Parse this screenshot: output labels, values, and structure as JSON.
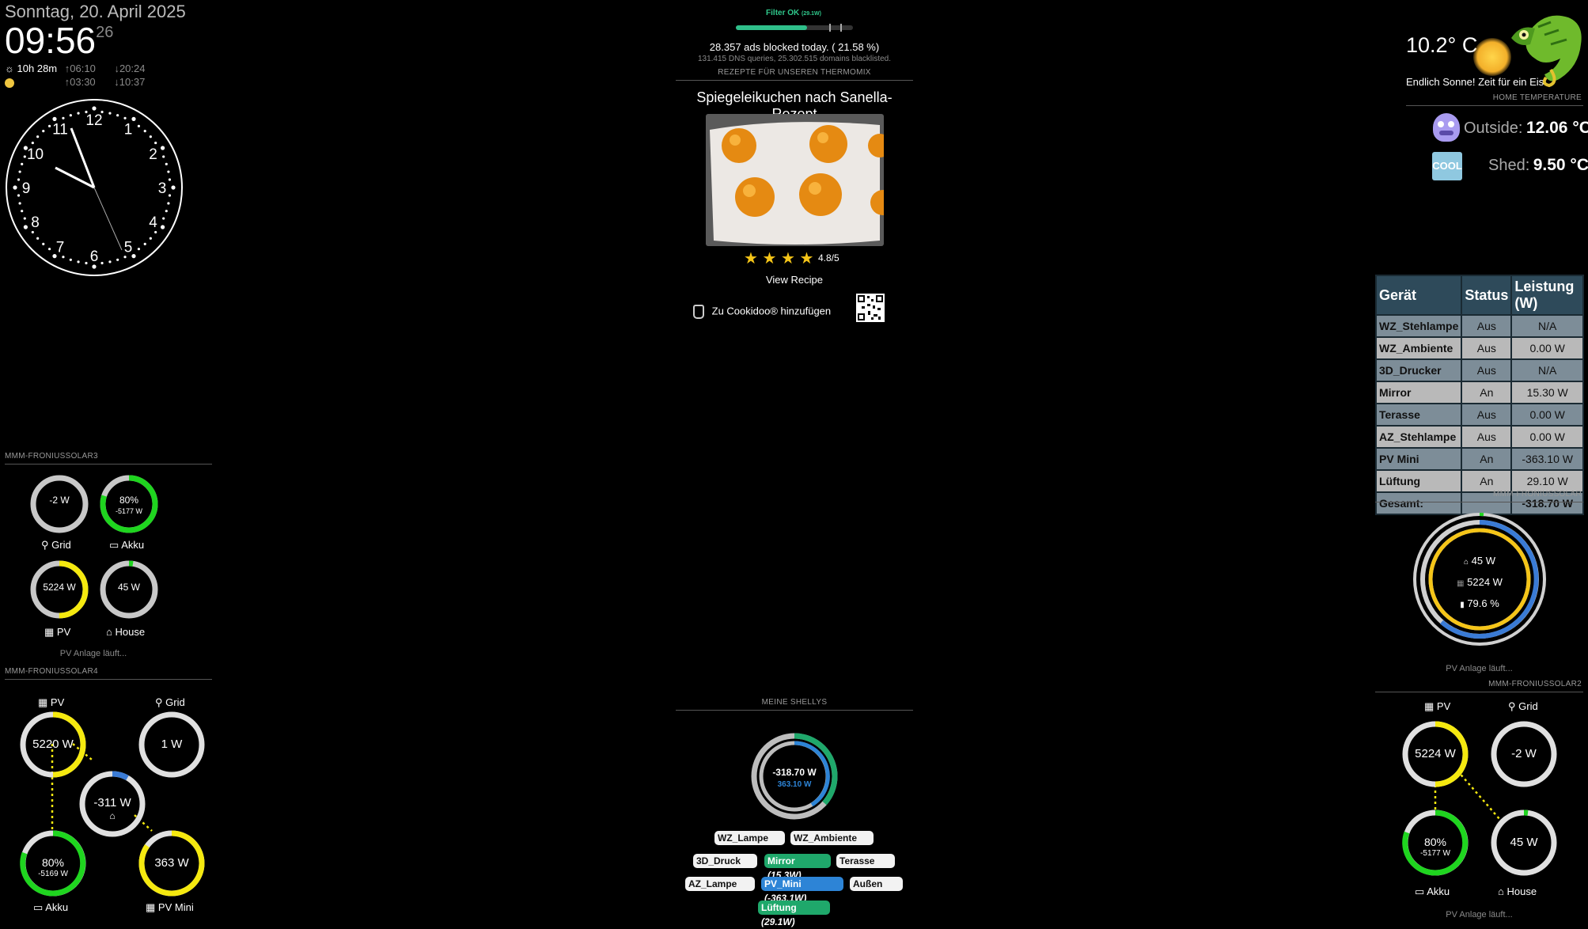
{
  "clock": {
    "date": "Sonntag, 20. April 2025",
    "time": "09:56",
    "seconds": "26",
    "daylight": "10h 28m",
    "sunrise": "06:10",
    "sunset": "20:24",
    "moonrise": "03:30",
    "moonset": "10:37",
    "analog_numbers": [
      "12",
      "1",
      "2",
      "3",
      "4",
      "5",
      "6",
      "7",
      "8",
      "9",
      "10",
      "11"
    ]
  },
  "pihole": {
    "filter": "Filter OK",
    "filter_power": "(29.1W)",
    "ads_blocked": "28.357 ads blocked today. ( 21.58 %)",
    "dns": "131.415 DNS queries, 25.302.515 domains blacklisted."
  },
  "recipe": {
    "header": "REZEPTE FÜR UNSEREN THERMOMIX",
    "title": "Spiegeleikuchen nach Sanella-Rezept",
    "rating": "4.8/5",
    "rating_value": 4.8,
    "view": "View Recipe",
    "cookidoo": "Zu Cookidoo® hinzufügen"
  },
  "weather": {
    "temp": "10.2° C",
    "text": "Endlich Sonne! Zeit für ein Eis"
  },
  "home_temp": {
    "header": "HOME TEMPERATURE",
    "outside_label": "Outside:",
    "outside_value": "12.06 °C",
    "shed_label": "Shed:",
    "shed_value": "9.50 °C",
    "cool_badge": "COOL"
  },
  "device_table": {
    "headers": [
      "Gerät",
      "Status",
      "Leistung (W)"
    ],
    "rows": [
      {
        "name": "WZ_Stehlampe",
        "status": "Aus",
        "power": "N/A"
      },
      {
        "name": "WZ_Ambiente",
        "status": "Aus",
        "power": "0.00 W"
      },
      {
        "name": "3D_Drucker",
        "status": "Aus",
        "power": "N/A"
      },
      {
        "name": "Mirror",
        "status": "An",
        "power": "15.30 W"
      },
      {
        "name": "Terasse",
        "status": "Aus",
        "power": "0.00 W"
      },
      {
        "name": "AZ_Stehlampe",
        "status": "Aus",
        "power": "0.00 W"
      },
      {
        "name": "PV Mini",
        "status": "An",
        "power": "-363.10 W"
      },
      {
        "name": "Lüftung",
        "status": "An",
        "power": "29.10 W"
      }
    ],
    "total_label": "Gesamt:",
    "total_value": "-318.70 W"
  },
  "solar3": {
    "header": "MMM-FRONIUSSOLAR3",
    "grid_value": "-2 W",
    "grid_label": "Grid",
    "akku_pct": "80%",
    "akku_sub": "-5177 W",
    "akku_label": "Akku",
    "akku_level": 0.8,
    "pv_value": "5224 W",
    "pv_label": "PV",
    "pv_level": 0.5,
    "house_value": "45 W",
    "house_label": "House",
    "status": "PV Anlage läuft..."
  },
  "solar4": {
    "header": "MMM-FRONIUSSOLAR4",
    "pv_label": "PV",
    "pv_value": "5220 W",
    "grid_label": "Grid",
    "grid_value": "1 W",
    "center_value": "-311 W",
    "akku_pct": "80%",
    "akku_sub": "-5169 W",
    "akku_label": "Akku",
    "mini_value": "363 W",
    "mini_label": "PV Mini"
  },
  "solar_ring": {
    "header": "MMM-FRONIUSSOLAR",
    "house": "45 W",
    "pv": "5224 W",
    "soc": "79.6 %",
    "status": "PV Anlage läuft..."
  },
  "solar2": {
    "header": "MMM-FRONIUSSOLAR2",
    "pv_label": "PV",
    "pv_value": "5224 W",
    "grid_label": "Grid",
    "grid_value": "-2 W",
    "akku_pct": "80%",
    "akku_sub": "-5177 W",
    "akku_label": "Akku",
    "house_value": "45 W",
    "house_label": "House",
    "status": "PV Anlage läuft..."
  },
  "shellys": {
    "header": "MEINE SHELLYS",
    "total": "-318.70 W",
    "pv": "363.10 W",
    "pills": [
      {
        "label": "WZ_Lampe",
        "extra": ""
      },
      {
        "label": "WZ_Ambiente",
        "extra": ""
      },
      {
        "label": "3D_Druck",
        "extra": ""
      },
      {
        "label": "Mirror",
        "extra": "(15.3W)"
      },
      {
        "label": "Terasse",
        "extra": ""
      },
      {
        "label": "AZ_Lampe",
        "extra": ""
      },
      {
        "label": "PV_Mini",
        "extra": "(-363.1W)"
      },
      {
        "label": "Außen",
        "extra": ""
      },
      {
        "label": "Lüftung",
        "extra": "(29.1W)"
      }
    ]
  },
  "colors": {
    "green": "#1fd51f",
    "yellow": "#f5e90f",
    "blue": "#3a7bd5",
    "gray_ring": "#c8c8c8",
    "table_header": "#2e4a5a"
  }
}
